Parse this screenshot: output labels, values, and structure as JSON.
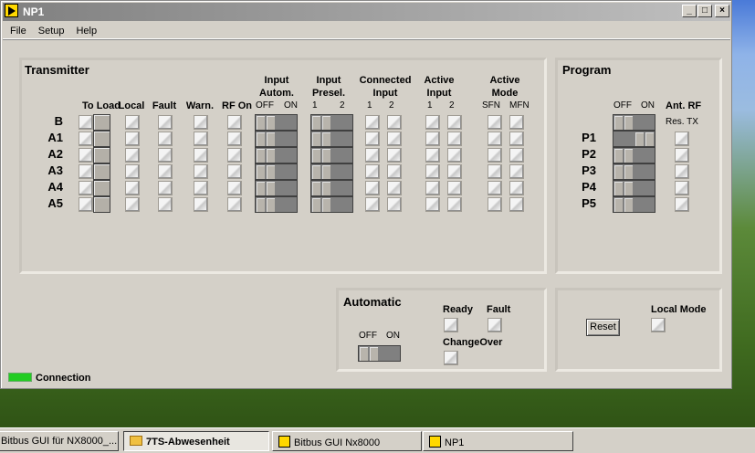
{
  "window": {
    "title": "NP1",
    "min": "_",
    "max": "□",
    "close": "×"
  },
  "menu": [
    "File",
    "Setup",
    "Help"
  ],
  "transmitter": {
    "title": "Transmitter",
    "rows": [
      "B",
      "A1",
      "A2",
      "A3",
      "A4",
      "A5"
    ],
    "headers": {
      "to_load": "To Load",
      "local": "Local",
      "fault": "Fault",
      "warn": "Warn.",
      "rf_on": "RF On",
      "input_autom": "Input\nAutom.",
      "input_presel": "Input\nPresel.",
      "connected_input": "Connected\nInput",
      "active_input": "Active\nInput",
      "active_mode": "Active\nMode"
    },
    "sub": {
      "off": "OFF",
      "on": "ON",
      "one": "1",
      "two": "2",
      "sfn": "SFN",
      "mfn": "MFN"
    },
    "input_autom_state": "OFF",
    "input_presel_state": "1"
  },
  "program": {
    "title": "Program",
    "off": "OFF",
    "on": "ON",
    "ant_rf": "Ant. RF",
    "res_tx": "Res. TX",
    "rows": [
      "P1",
      "P2",
      "P3",
      "P4",
      "P5"
    ],
    "switch_states": [
      "OFF",
      "ON",
      "OFF",
      "OFF",
      "OFF",
      "OFF"
    ]
  },
  "automatic": {
    "title": "Automatic",
    "off": "OFF",
    "on": "ON",
    "state": "OFF",
    "ready": "Ready",
    "fault": "Fault",
    "changeover": "ChangeOver"
  },
  "control": {
    "reset": "Reset",
    "local_mode": "Local Mode"
  },
  "status": {
    "connection": "Connection",
    "connection_color": "#22cc22"
  },
  "taskbar": [
    "Bitbus GUI für NX8000_...",
    "7TS-Abwesenheit",
    "Bitbus GUI Nx8000",
    "NP1"
  ]
}
